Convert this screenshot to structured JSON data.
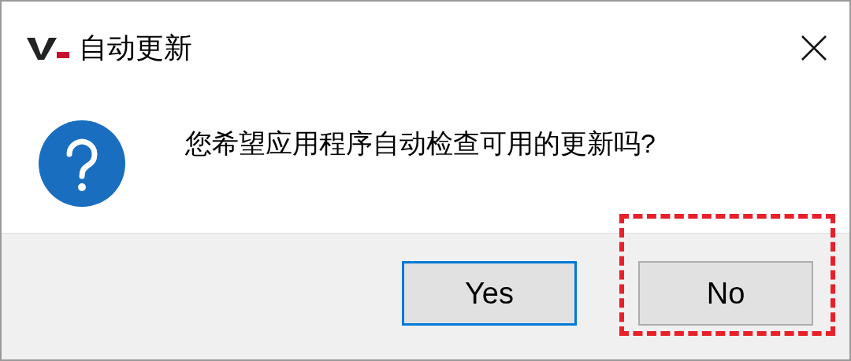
{
  "window": {
    "title": "自动更新"
  },
  "message": "您希望应用程序自动检查可用的更新吗?",
  "buttons": [
    {
      "label": "Yes",
      "focused": true,
      "highlighted": false
    },
    {
      "label": "No",
      "focused": false,
      "highlighted": true
    }
  ]
}
